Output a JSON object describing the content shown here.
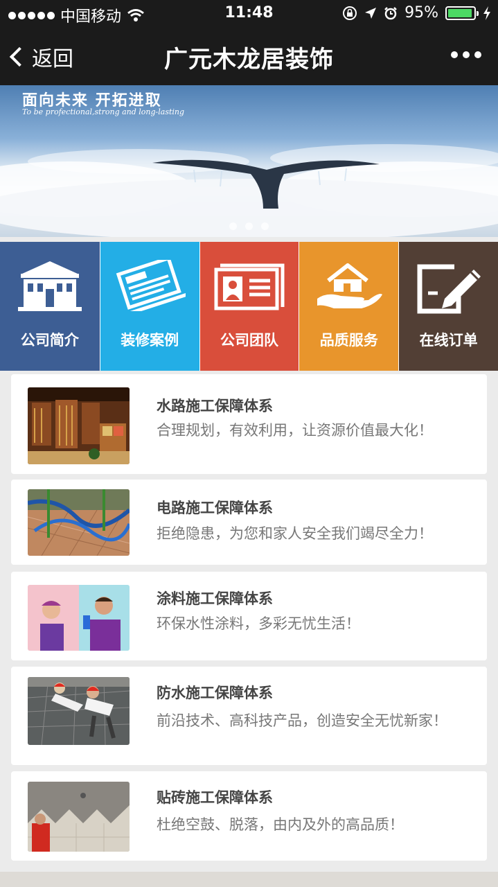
{
  "status_bar": {
    "carrier": "中国移动",
    "time": "11:48",
    "battery": "95%",
    "battery_level": 0.95
  },
  "nav": {
    "back_label": "返回",
    "title": "广元木龙居装饰"
  },
  "banner": {
    "title": "面向未来  开拓进取",
    "subtitle": "To be profectional,strong and long-lasting",
    "slides": 3
  },
  "tiles": [
    {
      "label": "公司简介",
      "icon": "building-icon",
      "color": "#3d5e94"
    },
    {
      "label": "装修案例",
      "icon": "newspaper-icon",
      "color": "#23aee6"
    },
    {
      "label": "公司团队",
      "icon": "id-card-icon",
      "color": "#d94e3b"
    },
    {
      "label": "品质服务",
      "icon": "house-hand-icon",
      "color": "#e8952c"
    },
    {
      "label": "在线订单",
      "icon": "edit-pen-icon",
      "color": "#523f35"
    }
  ],
  "items": [
    {
      "title": "水路施工保障体系",
      "desc": "合理规划，有效利用，让资源价值最大化！"
    },
    {
      "title": "电路施工保障体系",
      "desc": "拒绝隐患，为您和家人安全我们竭尽全力！"
    },
    {
      "title": "涂料施工保障体系",
      "desc": "环保水性涂料，多彩无忧生活！"
    },
    {
      "title": "防水施工保障体系",
      "desc": "前沿技术、高科技产品，创造安全无忧新家！"
    },
    {
      "title": "贴砖施工保障体系",
      "desc": "杜绝空鼓、脱落，由内及外的高品质！"
    }
  ]
}
